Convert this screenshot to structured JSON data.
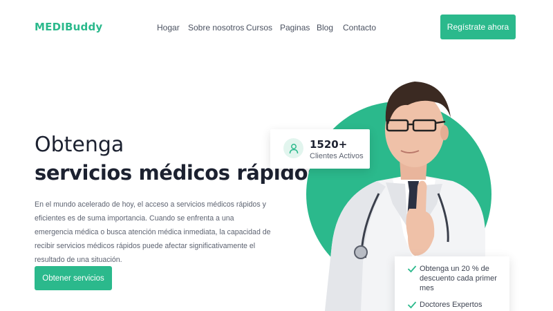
{
  "brand": {
    "name": "MEDIBuddy"
  },
  "nav": {
    "items": [
      {
        "label": "Hogar"
      },
      {
        "label": "Sobre nosotros"
      },
      {
        "label": "Cursos"
      },
      {
        "label": "Paginas"
      },
      {
        "label": "Blog"
      },
      {
        "label": "Contacto"
      }
    ],
    "cta_label": "Regístrate ahora"
  },
  "hero": {
    "title_line1": "Obtenga",
    "title_line2": "servicios médicos rápidos",
    "description": "En el mundo acelerado de hoy, el acceso a servicios médicos rápidos y eficientes es de suma importancia. Cuando se enfrenta a una emergencia médica o busca atención médica inmediata, la capacidad de recibir servicios médicos rápidos puede afectar significativamente el resultado de una situación.",
    "cta_label": "Obtener servicios"
  },
  "stats": {
    "value": "1520+",
    "label": "Clientes Activos",
    "icon": "user-icon"
  },
  "features": [
    {
      "text": "Obtenga un 20 % de descuento cada primer mes",
      "icon": "check-icon"
    },
    {
      "text": "Doctores Expertos",
      "icon": "check-icon"
    }
  ],
  "colors": {
    "accent": "#2bb98c",
    "heading": "#1c2130",
    "body_text": "#5d6371"
  }
}
